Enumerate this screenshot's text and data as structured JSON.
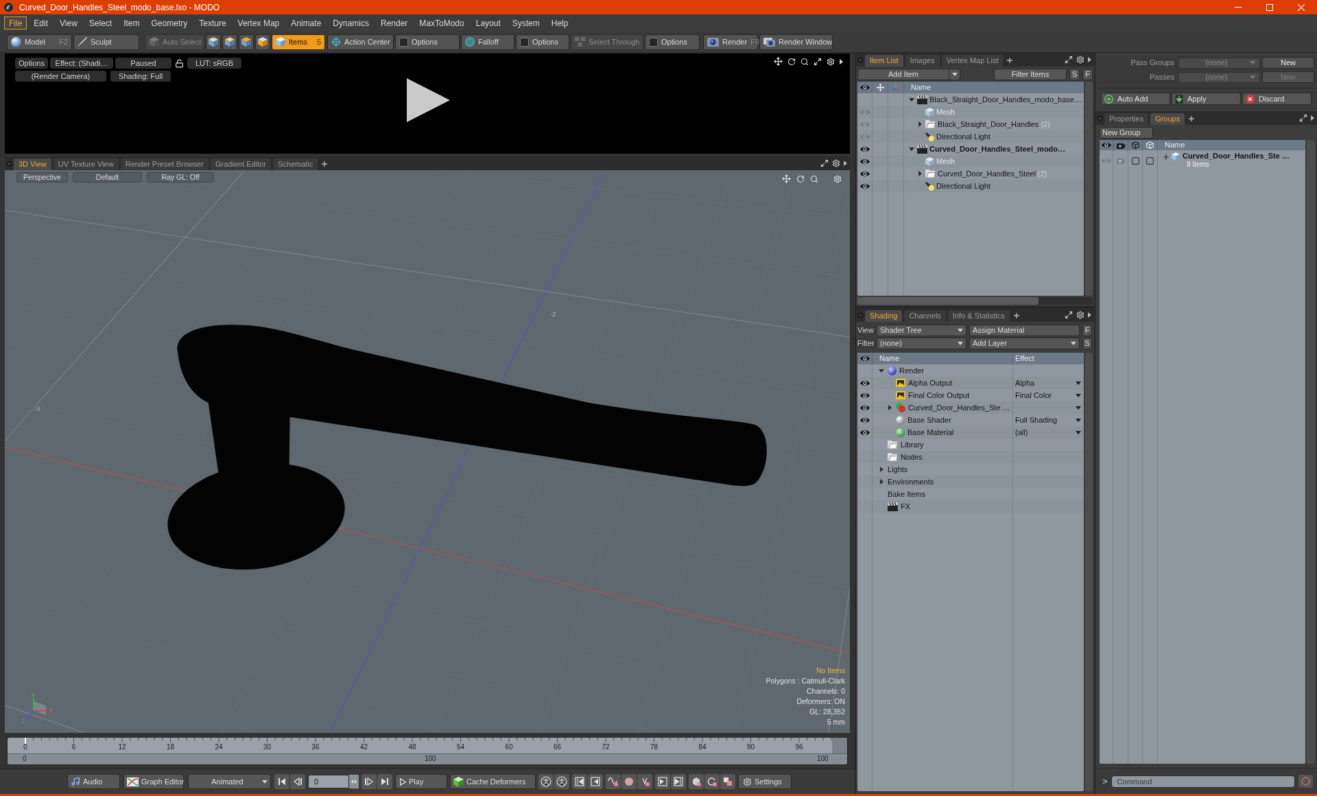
{
  "window": {
    "title": "Curved_Door_Handles_Steel_modo_base.lxo - MODO"
  },
  "menu": [
    {
      "label": "File",
      "selected": true
    },
    {
      "label": "Edit",
      "selected": false
    },
    {
      "label": "View",
      "selected": false
    },
    {
      "label": "Select",
      "selected": false
    },
    {
      "label": "Item",
      "selected": false
    },
    {
      "label": "Geometry",
      "selected": false
    },
    {
      "label": "Texture",
      "selected": false
    },
    {
      "label": "Vertex Map",
      "selected": false
    },
    {
      "label": "Animate",
      "selected": false
    },
    {
      "label": "Dynamics",
      "selected": false
    },
    {
      "label": "Render",
      "selected": false
    },
    {
      "label": "MaxToModo",
      "selected": false
    },
    {
      "label": "Layout",
      "selected": false
    },
    {
      "label": "System",
      "selected": false
    },
    {
      "label": "Help",
      "selected": false
    }
  ],
  "toolbar": [
    {
      "items": [
        {
          "kind": "button",
          "label": "Model",
          "shortcut": "F2",
          "selected": false,
          "disabled": false
        },
        {
          "kind": "button",
          "label": "Sculpt",
          "selected": false,
          "disabled": false
        }
      ]
    },
    {
      "items": [
        {
          "kind": "button",
          "label": "Auto Select",
          "selected": false,
          "disabled": true
        },
        {
          "kind": "icon",
          "selected": false,
          "disabled": false
        },
        {
          "kind": "icon",
          "selected": false,
          "disabled": false
        },
        {
          "kind": "icon",
          "selected": false,
          "disabled": false
        },
        {
          "kind": "icon",
          "selected": false,
          "disabled": false
        },
        {
          "kind": "button",
          "label": "Items",
          "shortcut": "5",
          "selected": true,
          "disabled": false
        }
      ]
    },
    {
      "items": [
        {
          "kind": "button",
          "label": "Action Center",
          "selected": false,
          "disabled": false
        },
        {
          "kind": "button",
          "label": "Options",
          "selected": false,
          "disabled": false
        }
      ]
    },
    {
      "items": [
        {
          "kind": "button",
          "label": "Falloff",
          "selected": false,
          "disabled": false
        },
        {
          "kind": "button",
          "label": "Options",
          "selected": false,
          "disabled": false
        }
      ]
    },
    {
      "items": [
        {
          "kind": "button",
          "label": "Select Through",
          "selected": false,
          "disabled": true
        },
        {
          "kind": "button",
          "label": "Options",
          "selected": false,
          "disabled": false
        }
      ]
    },
    {
      "items": [
        {
          "kind": "button",
          "label": "Render",
          "shortcut": "F9",
          "selected": false,
          "disabled": false
        },
        {
          "kind": "button",
          "label": "Render Window",
          "selected": false,
          "disabled": false
        }
      ]
    }
  ],
  "render_preview": {
    "row_1": [
      "Options",
      "Effect: (Shadi…",
      "Paused",
      "LUT: sRGB"
    ],
    "row_2": [
      "(Render Camera)",
      "Shading: Full"
    ]
  },
  "viewport_tabs": [
    {
      "label": "3D View",
      "selected": true
    },
    {
      "label": "UV Texture View",
      "selected": false
    },
    {
      "label": "Render Preset Browser",
      "selected": false
    },
    {
      "label": "Gradient Editor",
      "selected": false
    },
    {
      "label": "Schematic",
      "selected": false
    }
  ],
  "viewport": {
    "buttons": [
      "Perspective",
      "Default",
      "Ray GL: Off"
    ],
    "axis_labels": [
      "-Z",
      "-X"
    ],
    "gizmo_labels": [
      "Y",
      "X",
      "Z"
    ],
    "info_title": "No Items",
    "info_lines": [
      "Polygons : Catmull-Clark",
      "Channels: 0",
      "Deformers: ON",
      "GL: 28,352",
      "5 mm"
    ]
  },
  "timeline": {
    "level": 0,
    "frame_labels": [
      "0",
      "6",
      "12",
      "18",
      "24",
      "30",
      "36",
      "42",
      "48",
      "54",
      "60",
      "66",
      "72",
      "78",
      "84",
      "90",
      "96"
    ],
    "range_labels": [
      "0",
      "100",
      "100"
    ]
  },
  "bottom_toolbar": {
    "audio": "Audio",
    "graph_editor": "Graph Editor",
    "play_mode": "Animated",
    "frame": "0",
    "play": "Play",
    "cache": "Cache Deformers",
    "settings": "Settings"
  },
  "item_list": {
    "tabs": [
      {
        "label": "Item List",
        "selected": true
      },
      {
        "label": "Images",
        "selected": false
      },
      {
        "label": "Vertex Map List",
        "selected": false
      }
    ],
    "add_item": "Add Item",
    "filter_placeholder": "Filter Items",
    "filter_buttons": [
      "S",
      "F"
    ],
    "name_column": "Name",
    "items": [
      {
        "kind": "scene",
        "name": "Black_Straight_Door_Handles_modo_base…",
        "current": false,
        "expanded": true,
        "children": [
          {
            "kind": "mesh",
            "name": "Mesh",
            "visible": false
          },
          {
            "kind": "group",
            "name": "Black_Straight_Door_Handles",
            "count": "(2)",
            "visible": false,
            "expanded": false
          },
          {
            "kind": "light",
            "name": "Directional Light",
            "visible": false
          }
        ]
      },
      {
        "kind": "scene",
        "name": "Curved_Door_Handles_Steel_modo…",
        "current": true,
        "expanded": true,
        "children": [
          {
            "kind": "mesh",
            "name": "Mesh",
            "visible": true
          },
          {
            "kind": "group",
            "name": "Curved_Door_Handles_Steel",
            "count": "(2)",
            "visible": true,
            "expanded": false
          },
          {
            "kind": "light",
            "name": "Directional Light",
            "visible": true
          }
        ]
      }
    ]
  },
  "shading": {
    "tabs": [
      {
        "label": "Shading",
        "selected": true
      },
      {
        "label": "Channels",
        "selected": false
      },
      {
        "label": "Info & Statistics",
        "selected": false
      }
    ],
    "view_label": "View",
    "view_value": "Shader Tree",
    "assign_button": "Assign Material",
    "assign_key": "F",
    "filter_label": "Filter",
    "filter_value": "(none)",
    "add_layer": "Add Layer",
    "add_key": "S",
    "columns": [
      "Name",
      "Effect"
    ],
    "items": [
      {
        "kind": "render",
        "name": "Render",
        "expanded": true,
        "children": [
          {
            "kind": "output",
            "name": "Alpha Output",
            "effect": "Alpha",
            "visible": true
          },
          {
            "kind": "output",
            "name": "Final Color Output",
            "effect": "Final Color",
            "visible": true
          },
          {
            "kind": "material-group",
            "name": "Curved_Door_Handles_Ste …",
            "expanded": false,
            "visible": true
          },
          {
            "kind": "shader",
            "name": "Base Shader",
            "effect": "Full Shading",
            "visible": true
          },
          {
            "kind": "material",
            "name": "Base Material",
            "effect": "(all)",
            "visible": true
          }
        ]
      },
      {
        "kind": "folder",
        "name": "Library"
      },
      {
        "kind": "folder",
        "name": "Nodes"
      },
      {
        "kind": "list",
        "name": "Lights",
        "expanded": false
      },
      {
        "kind": "list",
        "name": "Environments",
        "expanded": false
      },
      {
        "kind": "list",
        "name": "Bake Items"
      },
      {
        "kind": "fx",
        "name": "FX"
      }
    ]
  },
  "passes": {
    "rows": [
      {
        "label": "Pass Groups",
        "value": "(none)",
        "button": "New",
        "disabled": false
      },
      {
        "label": "Passes",
        "value": "(none)",
        "button": "New",
        "disabled": true
      }
    ],
    "actions": [
      "Auto Add",
      "Apply",
      "Discard"
    ]
  },
  "groups": {
    "tabs": [
      {
        "label": "Properties",
        "selected": false
      },
      {
        "label": "Groups",
        "selected": true
      }
    ],
    "new_group": "New Group",
    "name_column": "Name",
    "items": [
      {
        "name": "Curved_Door_Handles_Ste …",
        "subtitle": "8 Items",
        "visible": false,
        "expanded": false
      }
    ]
  },
  "command": {
    "prompt": ">",
    "placeholder": "Command"
  }
}
